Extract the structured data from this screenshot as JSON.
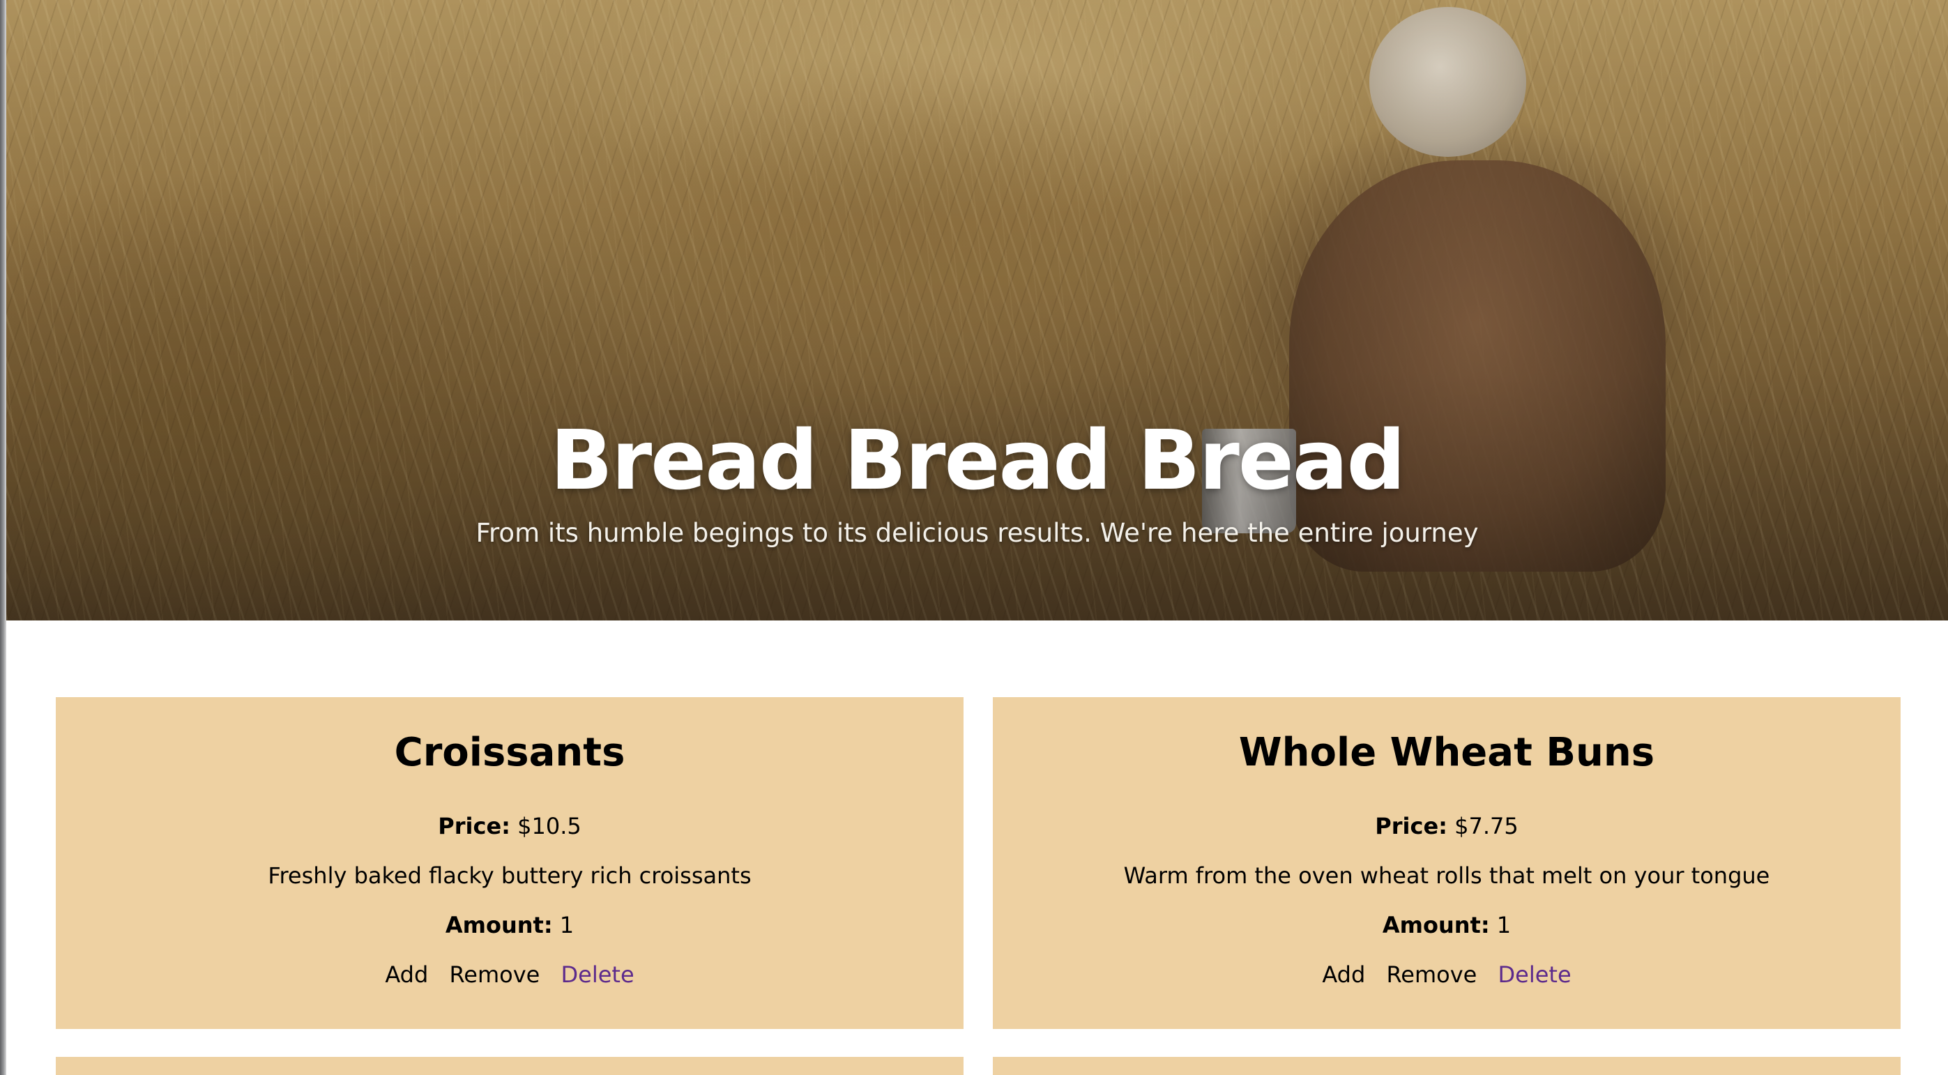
{
  "hero": {
    "title": "Bread Bread Bread",
    "subtitle": "From its humble begings to its delicious results. We're here the entire journey"
  },
  "products": [
    {
      "name": "Croissants",
      "price_label": "Price:",
      "price": "$10.5",
      "description": "Freshly baked flacky buttery rich croissants",
      "amount_label": "Amount:",
      "amount": "1",
      "add_label": "Add",
      "remove_label": "Remove",
      "delete_label": "Delete"
    },
    {
      "name": "Whole Wheat Buns",
      "price_label": "Price:",
      "price": "$7.75",
      "description": "Warm from the oven wheat rolls that melt on your tongue",
      "amount_label": "Amount:",
      "amount": "1",
      "add_label": "Add",
      "remove_label": "Remove",
      "delete_label": "Delete"
    }
  ],
  "colors": {
    "card_background": "#eed1a2",
    "delete_link": "#5c2a8c",
    "hero_text": "#ffffff"
  }
}
